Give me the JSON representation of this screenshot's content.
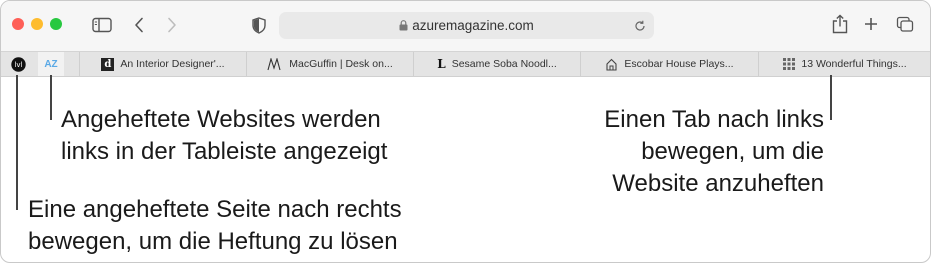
{
  "browser": {
    "url": "azuremagazine.com",
    "pinned_tabs": [
      {
        "icon": "mask-logo-icon",
        "label": ""
      },
      {
        "icon": "az-logo-icon",
        "label": "AZ"
      }
    ],
    "tabs": [
      {
        "icon": "d-logo-icon",
        "label": "An Interior Designer'..."
      },
      {
        "icon": "m-logo-icon",
        "label": "MacGuffin | Desk on..."
      },
      {
        "icon": "l-logo-icon",
        "label": "Sesame Soba Noodl..."
      },
      {
        "icon": "house-icon",
        "label": "Escobar House Plays..."
      },
      {
        "icon": "grid-logo-icon",
        "label": "13 Wonderful Things..."
      }
    ]
  },
  "callouts": {
    "pinned_left": {
      "line1": "Angeheftete Websites werden",
      "line2": "links in der Tableiste angezeigt"
    },
    "unpin": {
      "line1": "Eine angeheftete Seite nach rechts",
      "line2": "bewegen, um die Heftung zu lösen"
    },
    "pin": {
      "line1": "Einen Tab nach links",
      "line2": "bewegen, um die",
      "line3": "Website anzuheften"
    }
  },
  "colors": {
    "close": "#fe5f57",
    "minimize": "#febc2e",
    "zoom": "#28c840",
    "az_accent": "#5aa9e6"
  }
}
